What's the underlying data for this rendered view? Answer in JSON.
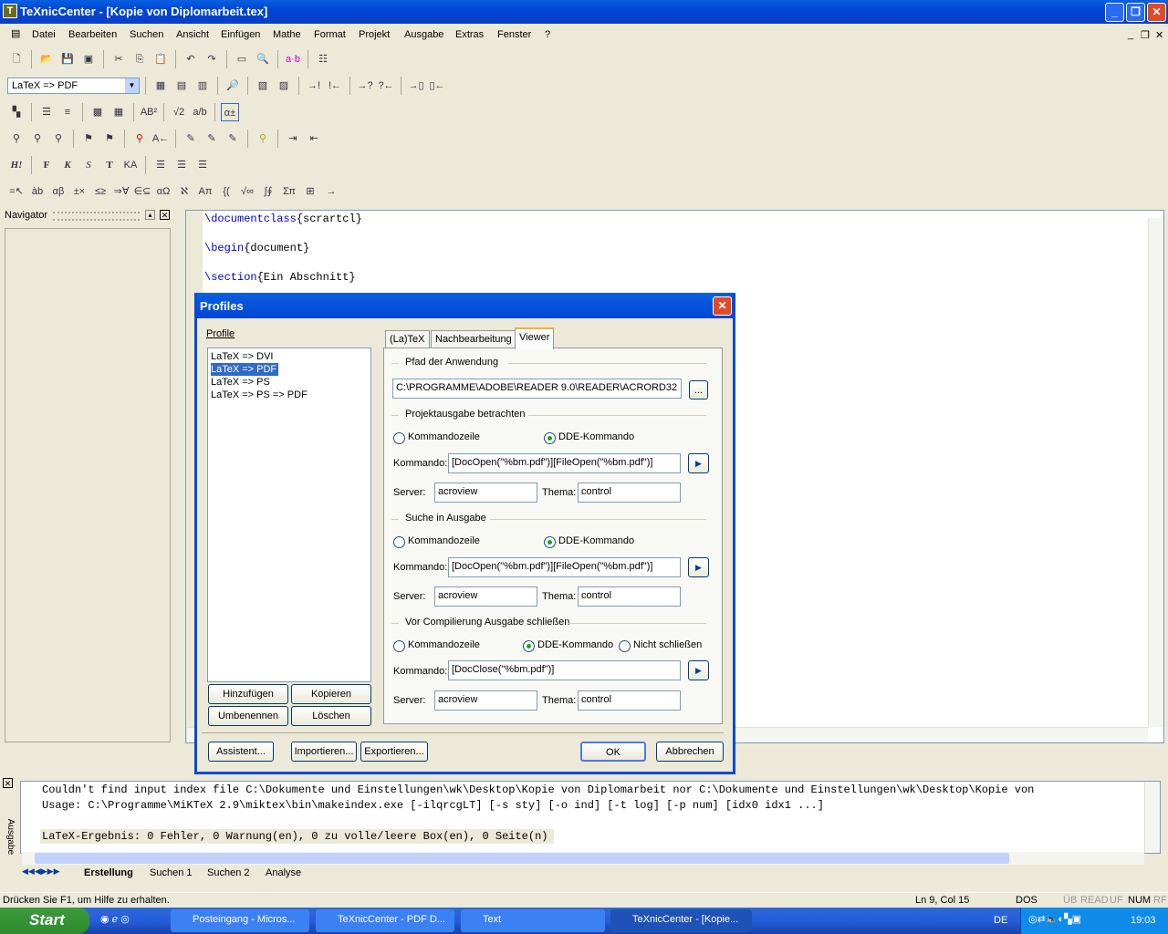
{
  "window": {
    "title": "TeXnicCenter - [Kopie von Diplomarbeit.tex]",
    "app_icon": "T"
  },
  "menu": [
    "Datei",
    "Bearbeiten",
    "Suchen",
    "Ansicht",
    "Einfügen",
    "Mathe",
    "Format",
    "Projekt",
    "Ausgabe",
    "Extras",
    "Fenster",
    "?"
  ],
  "toolbar": {
    "profile_combo": "LaTeX => PDF",
    "bold": "F",
    "italic": "K",
    "slanted": "S",
    "typewriter": "T",
    "caps": "KA",
    "heading": "H!"
  },
  "navigator": {
    "title": "Navigator"
  },
  "editor": {
    "lines": [
      {
        "cmd": "\\documentclass",
        "arg": "{scrartcl}"
      },
      {
        "cmd": "\\begin",
        "arg": "{document}"
      },
      {
        "cmd": "\\section",
        "arg": "{Ein Abschnitt}"
      }
    ]
  },
  "dialog": {
    "title": "Profiles",
    "profile_label": "Profile",
    "profiles": [
      "LaTeX => DVI",
      "LaTeX => PDF",
      "LaTeX => PS",
      "LaTeX => PS => PDF"
    ],
    "selected_profile": "LaTeX => PDF",
    "tabs": [
      "(La)TeX",
      "Nachbearbeitung",
      "Viewer"
    ],
    "active_tab": "Viewer",
    "path_group": "Pfad der Anwendung",
    "path_value": "C:\\PROGRAMME\\ADOBE\\READER 9.0\\READER\\ACRORD32",
    "browse": "...",
    "view_group": "Projektausgabe betrachten",
    "search_group": "Suche in Ausgabe",
    "close_group": "Vor Compilierung Ausgabe schließen",
    "opt_cmdline": "Kommandozeile",
    "opt_dde": "DDE-Kommando",
    "opt_noclose": "Nicht schließen",
    "kommando_label": "Kommando:",
    "server_label": "Server:",
    "thema_label": "Thema:",
    "view_cmd": "[DocOpen(\"%bm.pdf\")][FileOpen(\"%bm.pdf\")]",
    "view_server": "acroview",
    "view_thema": "control",
    "search_cmd": "[DocOpen(\"%bm.pdf\")][FileOpen(\"%bm.pdf\")]",
    "search_server": "acroview",
    "search_thema": "control",
    "close_cmd": "[DocClose(\"%bm.pdf\")]",
    "close_server": "acroview",
    "close_thema": "control",
    "buttons": {
      "add": "Hinzufügen",
      "copy": "Kopieren",
      "rename": "Umbenennen",
      "delete": "Löschen",
      "wizard": "Assistent...",
      "import": "Importieren...",
      "export": "Exportieren...",
      "ok": "OK",
      "cancel": "Abbrechen"
    }
  },
  "output": {
    "side_label": "Ausgabe",
    "lines": [
      "Couldn't find input index file C:\\Dokumente und Einstellungen\\wk\\Desktop\\Kopie von Diplomarbeit nor C:\\Dokumente und Einstellungen\\wk\\Desktop\\Kopie von",
      "Usage: C:\\Programme\\MiKTeX 2.9\\miktex\\bin\\makeindex.exe [-ilqrcgLT] [-s sty] [-o ind] [-t log] [-p num] [idx0 idx1 ...]"
    ],
    "result": "LaTeX-Ergebnis: 0 Fehler, 0 Warnung(en), 0 zu volle/leere Box(en), 0 Seite(n)",
    "tabs": [
      "Erstellung",
      "Suchen 1",
      "Suchen 2",
      "Analyse"
    ]
  },
  "status": {
    "help": "Drücken Sie F1, um Hilfe zu erhalten.",
    "position": "Ln 9, Col 15",
    "format": "DOS",
    "indicators": [
      "ÜB",
      "READ",
      "UF",
      "NUM",
      "RF"
    ]
  },
  "taskbar": {
    "start": "Start",
    "tasks": [
      "Posteingang - Micros...",
      "TeXnicCenter - PDF D...",
      "Text",
      "TeXnicCenter - [Kopie..."
    ],
    "lang": "DE",
    "clock": "19:03"
  }
}
